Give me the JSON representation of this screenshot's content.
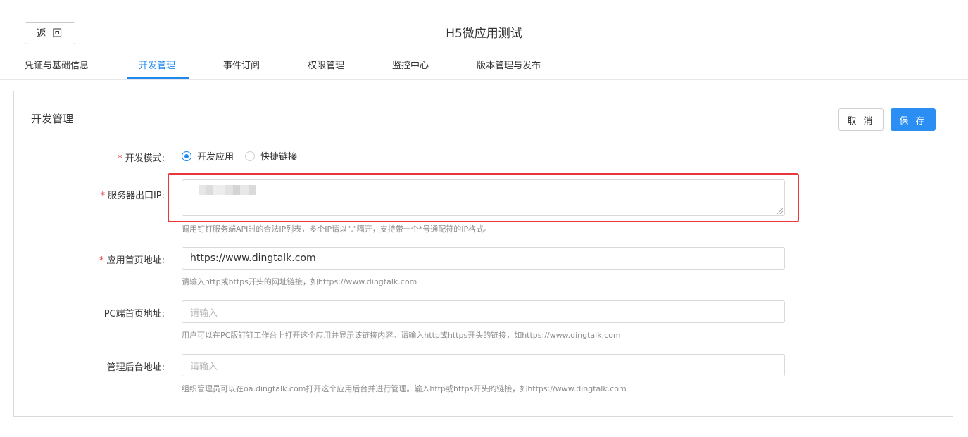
{
  "header": {
    "back_label": "返 回",
    "title": "H5微应用测试"
  },
  "tabs": [
    {
      "label": "凭证与基础信息",
      "active": false
    },
    {
      "label": "开发管理",
      "active": true
    },
    {
      "label": "事件订阅",
      "active": false
    },
    {
      "label": "权限管理",
      "active": false
    },
    {
      "label": "监控中心",
      "active": false
    },
    {
      "label": "版本管理与发布",
      "active": false
    }
  ],
  "panel": {
    "title": "开发管理",
    "cancel_label": "取 消",
    "save_label": "保 存"
  },
  "form": {
    "dev_mode": {
      "required_mark": "*",
      "label": "开发模式:",
      "options": [
        "开发应用",
        "快捷链接"
      ],
      "selected": "开发应用"
    },
    "server_ip": {
      "required_mark": "*",
      "label": "服务器出口IP:",
      "hint": "调用钉钉服务端API时的合法IP列表，多个IP请以\",\"隔开，支持带一个*号通配符的IP格式。"
    },
    "homepage_url": {
      "required_mark": "*",
      "label": "应用首页地址:",
      "value": "https://www.dingtalk.com",
      "hint": "请输入http或https开头的网址链接，如https://www.dingtalk.com"
    },
    "pc_homepage_url": {
      "label": "PC端首页地址:",
      "placeholder": "请输入",
      "hint": "用户可以在PC版钉钉工作台上打开这个应用并显示该链接内容。请输入http或https开头的链接，如https://www.dingtalk.com"
    },
    "admin_url": {
      "label": "管理后台地址:",
      "placeholder": "请输入",
      "hint": "组织管理员可以在oa.dingtalk.com打开这个应用后台并进行管理。输入http或https开头的链接，如https://www.dingtalk.com"
    }
  },
  "colors": {
    "accent": "#1f89f1",
    "required": "#e8383d",
    "highlight": "#e8383d"
  }
}
